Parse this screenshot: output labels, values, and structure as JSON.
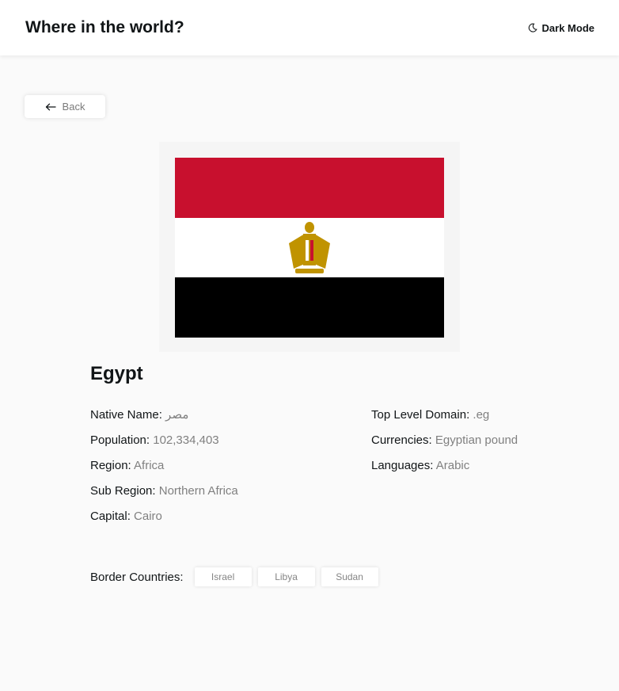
{
  "header": {
    "title": "Where in the world?",
    "dark_mode_label": "Dark Mode",
    "dark_mode_icon": "moon-icon"
  },
  "back_button": {
    "label": "Back",
    "icon": "arrow-left-icon"
  },
  "country": {
    "name": "Egypt",
    "flag_colors": [
      "#c8102e",
      "#ffffff",
      "#000000"
    ],
    "details_left": [
      {
        "label": "Native Name:",
        "value": "مصر"
      },
      {
        "label": "Population:",
        "value": "102,334,403"
      },
      {
        "label": "Region:",
        "value": "Africa"
      },
      {
        "label": "Sub Region:",
        "value": "Northern Africa"
      },
      {
        "label": "Capital:",
        "value": "Cairo"
      }
    ],
    "details_right": [
      {
        "label": "Top Level Domain:",
        "value": ".eg"
      },
      {
        "label": "Currencies:",
        "value": "Egyptian pound"
      },
      {
        "label": "Languages:",
        "value": "Arabic"
      }
    ],
    "border_label": "Border Countries:",
    "borders": [
      "Israel",
      "Libya",
      "Sudan"
    ]
  }
}
